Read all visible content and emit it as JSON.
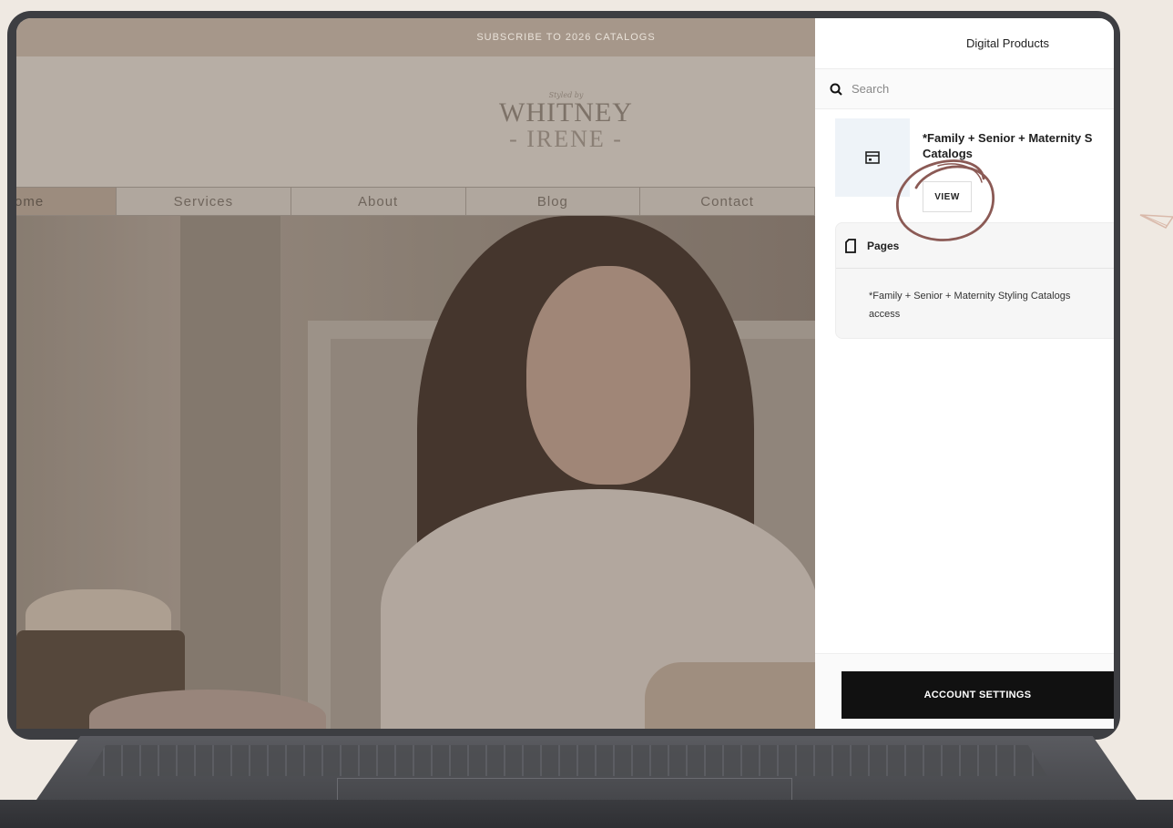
{
  "site": {
    "announcement": "SUBSCRIBE TO 2026 CATALOGS",
    "logo": {
      "tagline": "Styled by",
      "name": "WHITNEY",
      "subname": "- IRENE -"
    },
    "nav": [
      {
        "label": "ome"
      },
      {
        "label": "Services"
      },
      {
        "label": "About"
      },
      {
        "label": "Blog"
      },
      {
        "label": "Contact"
      }
    ]
  },
  "panel": {
    "title": "Digital Products",
    "search_placeholder": "Search",
    "product": {
      "title_line1": "*Family + Senior + Maternity S",
      "title_line2": "Catalogs",
      "view_label": "VIEW"
    },
    "pages": {
      "heading": "Pages",
      "line1": "*Family + Senior + Maternity Styling Catalogs",
      "line2": "access"
    },
    "account_button": "ACCOUNT SETTINGS"
  },
  "colors": {
    "annotation_circle": "#8b5a55",
    "announce_bar": "#a6978a",
    "account_button_bg": "#111111"
  }
}
